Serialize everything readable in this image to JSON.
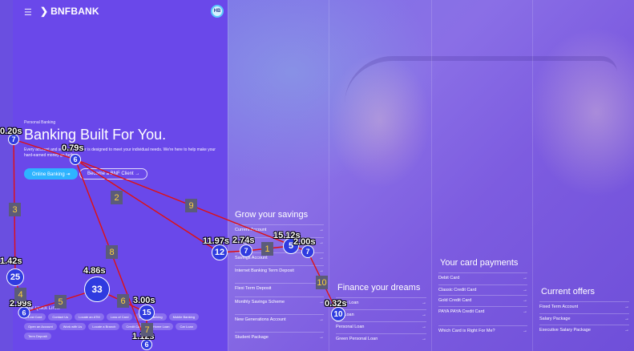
{
  "header": {
    "menu_icon": "hamburger-icon",
    "logo_mark": "❯",
    "logo_text": "BNFBANK",
    "avatar_initials": "HB"
  },
  "hero": {
    "eyebrow": "Personal Banking",
    "headline": "Banking Built For You.",
    "subcopy": "Every account and service we offer is designed to meet your individual needs. We're here to help make your hard-earned money go further.",
    "btn_online": "Online Banking ⇥",
    "btn_client": "Become a BNF Client →"
  },
  "quick_links": {
    "title": "Your Quick Links",
    "items": [
      "Lost Card",
      "Contact Us",
      "Locate an ATM",
      "Loss of Card",
      "Internet Banking",
      "Mobile Banking",
      "Open an Account",
      "Work with Us",
      "Locate a Branch",
      "Credit Card",
      "Home Loan",
      "Car Loan",
      "Term Deposit"
    ]
  },
  "columns": [
    {
      "title": "Grow your savings",
      "items": [
        "Current Account",
        "Attrattivi",
        "Savings Account",
        "Internet Banking Term Deposit",
        "Flexi Term Deposit",
        "Monthly Savings Scheme",
        "New Generations Account",
        "Student Package"
      ]
    },
    {
      "title": "Finance your dreams",
      "items": [
        "Home Loan",
        "Car Loan",
        "Personal Loan",
        "Green Personal Loan"
      ]
    },
    {
      "title": "Your card payments",
      "items": [
        "Debit Card",
        "Classic Credit Card",
        "Gold Credit Card",
        "PAYA PAYA Credit Card",
        "Which Card is Right For Me?"
      ]
    },
    {
      "title": "Current offers",
      "items": [
        "Fixed Term Account",
        "Salary Package",
        "Executive Salary Package"
      ]
    }
  ],
  "arrow_glyph": "→",
  "gaze": {
    "fixations": [
      {
        "n": "7"
      },
      {
        "n": "6"
      },
      {
        "n": "12"
      },
      {
        "n": "7"
      },
      {
        "n": "5"
      },
      {
        "n": "7"
      },
      {
        "n": "25"
      },
      {
        "n": "6"
      },
      {
        "n": "33"
      },
      {
        "n": "15"
      },
      {
        "n": "6"
      },
      {
        "n": "10"
      }
    ],
    "times": [
      "0.20s",
      "0.79s",
      "11.97s",
      "2.74s",
      "15.12s",
      "2.00s",
      "1.42s",
      "2.99s",
      "4.86s",
      "3.00s",
      "1.12s",
      "0.32s"
    ],
    "segments": [
      "1",
      "2",
      "3",
      "4",
      "5",
      "6",
      "7",
      "8",
      "9",
      "10"
    ]
  }
}
